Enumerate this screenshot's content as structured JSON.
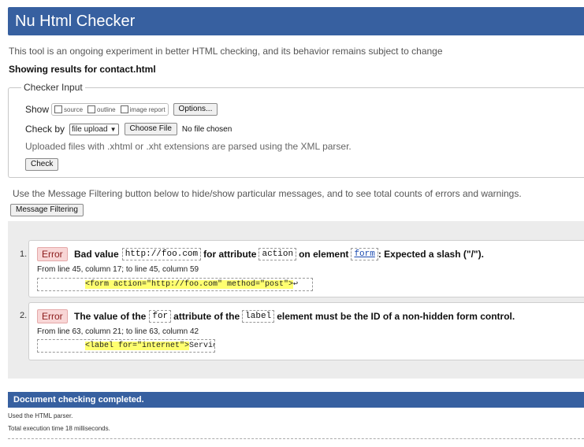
{
  "header": {
    "title": "Nu Html Checker"
  },
  "intro": "This tool is an ongoing experiment in better HTML checking, and its behavior remains subject to change",
  "showing_results": "Showing results for contact.html",
  "checker_input": {
    "legend": "Checker Input",
    "show_label": "Show",
    "show_options": [
      "source",
      "outline",
      "image report"
    ],
    "options_button": "Options...",
    "check_by_label": "Check by",
    "check_by_value": "file upload",
    "choose_file_button": "Choose File",
    "no_file": "No file chosen",
    "uploaded_note": "Uploaded files with .xhtml or .xht extensions are parsed using the XML parser.",
    "check_button": "Check"
  },
  "filter": {
    "note": "Use the Message Filtering button below to hide/show particular messages, and to see total counts of errors and warnings.",
    "button": "Message Filtering"
  },
  "messages": [
    {
      "num": "1.",
      "type": "Error",
      "parts": [
        "Bad value",
        "http://foo.com",
        "for attribute",
        "action",
        "on element",
        "form",
        ": Expected a slash (\"/\")."
      ],
      "location": "From line 45, column 17; to line 45, column 59",
      "extract_hl": "<form action=\"http://foo.com\" method=\"post\">",
      "extract_tail": "↩"
    },
    {
      "num": "2.",
      "type": "Error",
      "parts": [
        "The value of the",
        "for",
        "attribute of the",
        "label",
        "element must be the ID of a non-hidden form control."
      ],
      "location": "From line 63, column 21; to line 63, column 42",
      "extract_hl": "<label for=\"internet\">",
      "extract_tail": "Servic"
    }
  ],
  "footer": {
    "done": "Document checking completed.",
    "parser": "Used the HTML parser.",
    "time": "Total execution time 18 milliseconds."
  },
  "colors": {
    "header_bg": "#3760a0",
    "error_bg": "#f8d6d6",
    "highlight": "#ffff70"
  }
}
